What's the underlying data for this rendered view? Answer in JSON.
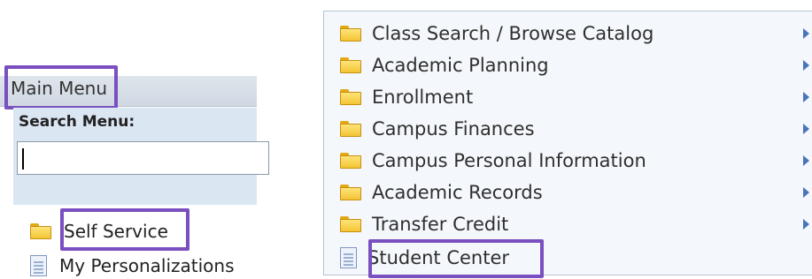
{
  "left_panel": {
    "main_menu_label": "Main Menu",
    "search_label": "Search Menu:",
    "search_value": "",
    "items": [
      {
        "label": "Self Service",
        "icon": "folder-icon"
      },
      {
        "label": "My Personalizations",
        "icon": "page-icon"
      }
    ]
  },
  "right_menu": {
    "items": [
      {
        "label": "Class Search / Browse Catalog",
        "icon": "folder-icon",
        "has_submenu": true
      },
      {
        "label": "Academic Planning",
        "icon": "folder-icon",
        "has_submenu": true
      },
      {
        "label": "Enrollment",
        "icon": "folder-icon",
        "has_submenu": true
      },
      {
        "label": "Campus Finances",
        "icon": "folder-icon",
        "has_submenu": true
      },
      {
        "label": "Campus Personal Information",
        "icon": "folder-icon",
        "has_submenu": true
      },
      {
        "label": "Academic Records",
        "icon": "folder-icon",
        "has_submenu": true
      },
      {
        "label": "Transfer Credit",
        "icon": "folder-icon",
        "has_submenu": true
      },
      {
        "label": "Student Center",
        "icon": "page-icon",
        "has_submenu": false
      }
    ]
  },
  "colors": {
    "highlight": "#7a4fc0",
    "menu_background": "#f4f7fb",
    "search_panel": "#dbe6f3",
    "submenu_arrow": "#4a74b8"
  }
}
